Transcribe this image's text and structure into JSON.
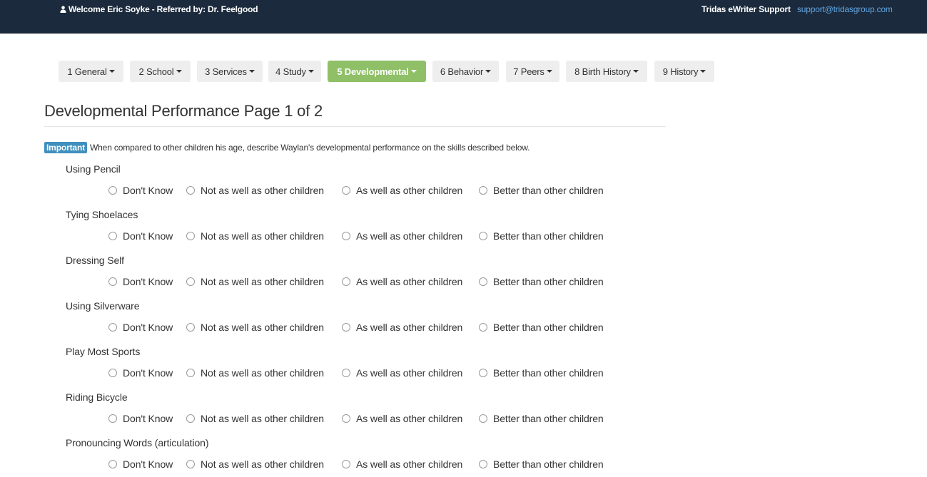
{
  "header": {
    "welcome": "Welcome Eric Soyke - Referred by: Dr. Feelgood",
    "user_icon": "user-icon",
    "support_label": "Tridas eWriter Support",
    "support_email": "support@tridasgroup.com"
  },
  "tabs": [
    {
      "label": "1 General",
      "active": false
    },
    {
      "label": "2 School",
      "active": false
    },
    {
      "label": "3 Services",
      "active": false
    },
    {
      "label": "4 Study",
      "active": false
    },
    {
      "label": "5 Developmental",
      "active": true
    },
    {
      "label": "6 Behavior",
      "active": false
    },
    {
      "label": "7 Peers",
      "active": false
    },
    {
      "label": "8 Birth History",
      "active": false
    },
    {
      "label": "9 History",
      "active": false
    }
  ],
  "page_title": "Developmental Performance Page 1 of 2",
  "important": {
    "badge": "Important",
    "text": "When compared to other children his age, describe Waylan's developmental performance on the skills described below."
  },
  "options": [
    "Don't Know",
    "Not as well as other children",
    "As well as other children",
    "Better than other children"
  ],
  "skills": [
    {
      "label": "Using Pencil"
    },
    {
      "label": "Tying Shoelaces"
    },
    {
      "label": "Dressing Self"
    },
    {
      "label": "Using Silverware"
    },
    {
      "label": "Play Most Sports"
    },
    {
      "label": "Riding Bicycle"
    },
    {
      "label": "Pronouncing Words (articulation)"
    }
  ],
  "colors": {
    "topbar": "#1b2a3c",
    "active_tab": "#8fc067",
    "badge": "#3f8fbf",
    "link": "#63a8e6"
  }
}
